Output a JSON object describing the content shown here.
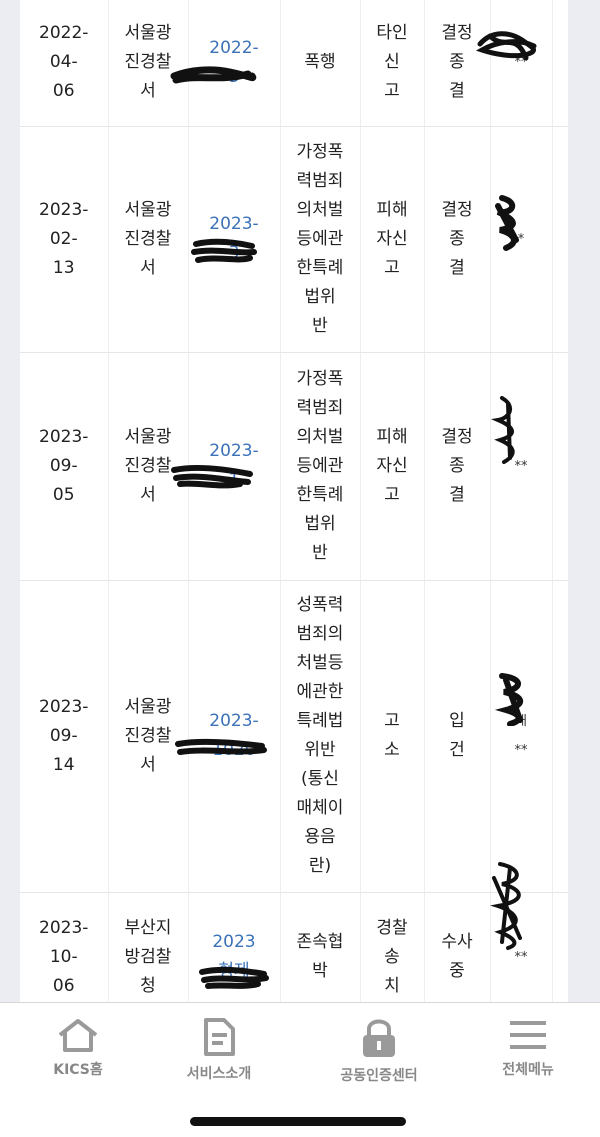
{
  "cases": [
    {
      "date": "2022-\n04-\n06",
      "agency": "서울광\n진경찰\n서",
      "case_no": "2022-\n  3",
      "charge": "폭행",
      "receipt": "타인\n신\n고",
      "result": "결정\n종\n결",
      "note": "**"
    },
    {
      "date": "2023-\n02-\n13",
      "agency": "서울광\n진경찰\n서",
      "case_no": "2023-\n  3",
      "charge": "가정폭\n력범죄\n의처벌\n등에관\n한특례\n법위\n반",
      "receipt": "피해\n자신\n고",
      "result": "결정\n종\n결",
      "note": "*"
    },
    {
      "date": "2023-\n09-\n05",
      "agency": "서울광\n진경찰\n서",
      "case_no": "2023-\n  1",
      "charge": "가정폭\n력범죄\n의처벌\n등에관\n한특례\n법위\n반",
      "receipt": "피해\n자신\n고",
      "result": "결정\n종\n결",
      "note": "**"
    },
    {
      "date": "2023-\n09-\n14",
      "agency": "서울광\n진경찰\n서",
      "case_no": "2023-\n1020",
      "charge": "성폭력\n범죄의\n처벌등\n에관한\n특례법\n위반\n(통신\n매체이\n용음\n란)",
      "receipt": "고\n소",
      "result": "입\n건",
      "note": "재\n**"
    },
    {
      "date": "2023-\n10-\n06",
      "agency": "부산지\n방검찰\n청",
      "case_no": "2023\n형제\n",
      "charge": "존속협\n박",
      "receipt": "경찰\n송\n치",
      "result": "수사\n중",
      "note": "**"
    }
  ],
  "bottom_nav": {
    "home": "KICS홈",
    "service": "서비스소개",
    "cert": "공동인증센터",
    "menu": "전체메뉴"
  },
  "colors": {
    "link": "#3b72b8",
    "nav_icon": "#9a9a9a",
    "side_bg": "#ebedf2"
  }
}
